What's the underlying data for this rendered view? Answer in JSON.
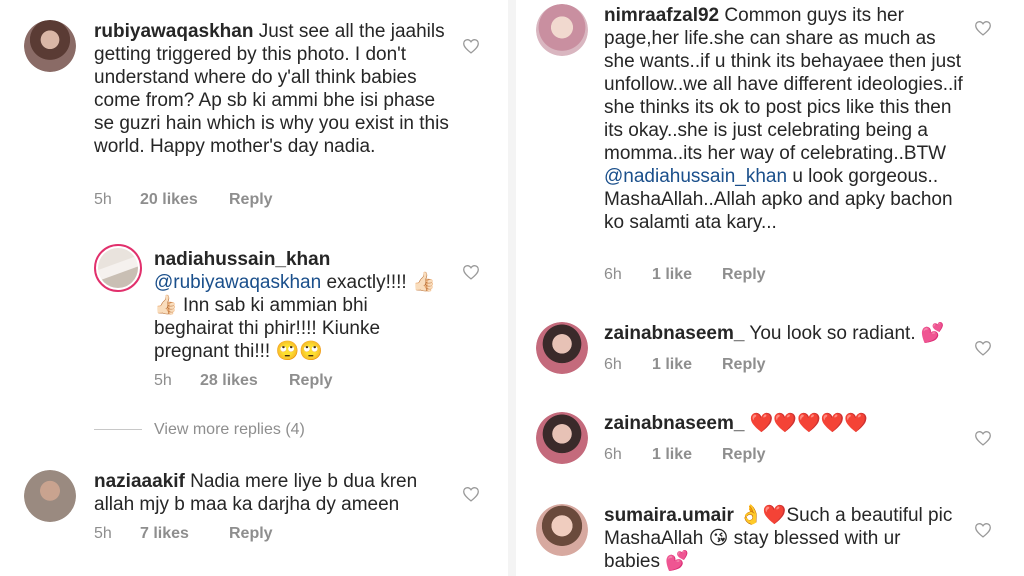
{
  "colors": {
    "link": "#1a4f8b",
    "meta": "#8e8e8e",
    "heart_red": "#e0245e",
    "story_ring": "#e1306c"
  },
  "left": {
    "comments": [
      {
        "username": "rubiyawaqaskhan",
        "text": " Just see all the jaahils getting triggered by this photo. I don't understand where do y'all think babies come from? Ap sb ki ammi bhe isi phase se guzri hain which is why you exist in this world. Happy mother's day nadia.",
        "time": "5h",
        "likes": "20 likes",
        "reply": "Reply",
        "icon": "heart-outline-icon"
      },
      {
        "username": "nadiahussain_khan",
        "mention": "@rubiyawaqaskhan",
        "text_a": " exactly!!!! ",
        "emoji_a": "👍🏻👍🏻",
        "text_b": " Inn sab ki ammian bhi beghairat thi phir!!!! Kiunke pregnant thi!!! ",
        "emoji_b": "🙄🙄",
        "time": "5h",
        "likes": "28 likes",
        "reply": "Reply",
        "icon": "heart-outline-icon"
      },
      {
        "username": "naziaaakif",
        "text": " Nadia mere liye b dua kren allah mjy b maa ka darjha dy ameen",
        "time": "5h",
        "likes": "7 likes",
        "reply": "Reply",
        "icon": "heart-outline-icon"
      }
    ],
    "view_more": "View more replies (4)"
  },
  "right": {
    "comments": [
      {
        "username": "nimraafzal92",
        "text_a": " Common guys its her page,her life.she can share as much as she wants..if u think its behayaee then just unfollow..we all have different ideologies..if she thinks its ok to post pics like this then its okay..she is just celebrating being a momma..its her way of celebrating..BTW ",
        "mention": "@nadiahussain_khan",
        "text_b": " u look gorgeous.. MashaAllah..Allah apko and apky bachon ko salamti ata kary...",
        "time": "6h",
        "likes": "1 like",
        "reply": "Reply",
        "icon": "heart-outline-icon"
      },
      {
        "username": "zainabnaseem_",
        "text": " You look so radiant. ",
        "emoji": "💕",
        "time": "6h",
        "likes": "1 like",
        "reply": "Reply",
        "icon": "heart-outline-icon"
      },
      {
        "username": "zainabnaseem_",
        "text": " ",
        "emoji": "❤️❤️❤️❤️❤️",
        "time": "6h",
        "likes": "1 like",
        "reply": "Reply",
        "icon": "heart-outline-icon"
      },
      {
        "username": "sumaira.umair",
        "emoji_a": " 👌❤️",
        "text_a": "Such a beautiful pic MashaAllah ",
        "emoji_b": "😘",
        "text_b": " stay blessed with ur babies ",
        "emoji_c": "💕",
        "icon": "heart-outline-icon"
      }
    ]
  }
}
